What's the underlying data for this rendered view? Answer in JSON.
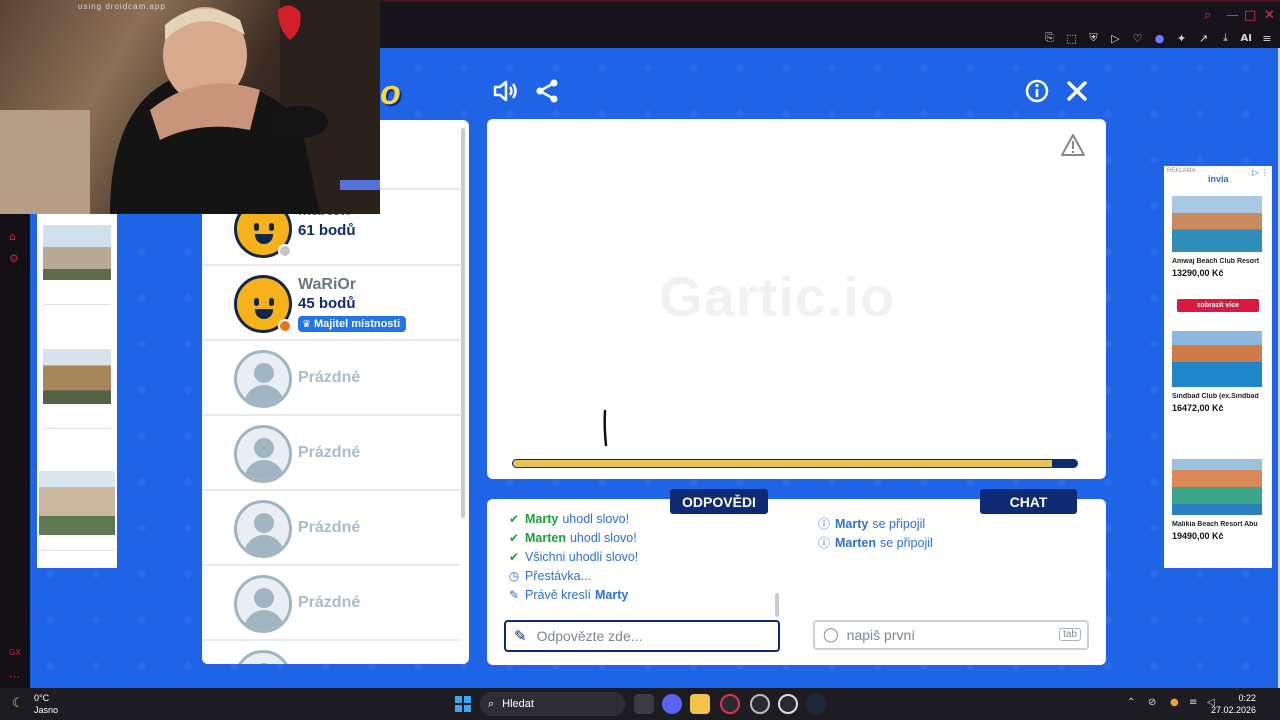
{
  "webcam": {
    "caption": "using droidcam.app"
  },
  "browser": {
    "ai_label": "AI"
  },
  "game": {
    "players": [
      {
        "name": "Marten",
        "score": "61 bodů",
        "status_color": "#c6c6c6"
      },
      {
        "name": "WaRiOr",
        "score": "45 bodů",
        "badge": "Majitel místnosti",
        "status_color": "#e8751a"
      }
    ],
    "empty_slot_label": "Prázdné",
    "canvas": {
      "watermark": "Gartic.io",
      "timer_fraction": 0.955
    },
    "answers": {
      "tab_label": "ODPOVĚDI",
      "lines": [
        {
          "name": "Marty",
          "text": "uhodl slovo!",
          "type": "correct"
        },
        {
          "name": "Marten",
          "text": "uhodl slovo!",
          "type": "correct"
        },
        {
          "name": "",
          "text": "Všichni uhodli slovo!",
          "type": "correct"
        },
        {
          "name": "",
          "text": "Přestávka...",
          "type": "clock"
        },
        {
          "prefix": "Právě kreslí",
          "name": "Marty",
          "type": "pencil"
        }
      ],
      "input_placeholder": "Odpovězte zde..."
    },
    "chat": {
      "tab_label": "CHAT",
      "lines": [
        {
          "name": "Marty",
          "text": "se připojil"
        },
        {
          "name": "Marten",
          "text": "se připojil"
        }
      ],
      "input_placeholder": "napiš první",
      "tab_hint": "tab"
    }
  },
  "right_ad": {
    "label": "REKLAMA",
    "brand": "invia",
    "more_button": "zobrazit více",
    "items": [
      {
        "name": "Amwaj Beach Club Resort",
        "price": "13290,00 Kč"
      },
      {
        "name": "Sindbad Club (ex.Sindbad",
        "price": "16472,00 Kč"
      },
      {
        "name": "Malikia Beach Resort Abu",
        "price": "19490,00 Kč"
      }
    ]
  },
  "taskbar": {
    "weather_temp": "0°C",
    "weather_desc": "Jasno",
    "search_label": "Hledat",
    "time": "0:22",
    "date": "27.02.2026"
  },
  "colors": {
    "page_blue": "#1f63e6",
    "navy": "#0d2a73",
    "answer_blue": "#2e6fd8",
    "correct_green": "#18a33b",
    "timer_yellow": "#e7c35a"
  }
}
